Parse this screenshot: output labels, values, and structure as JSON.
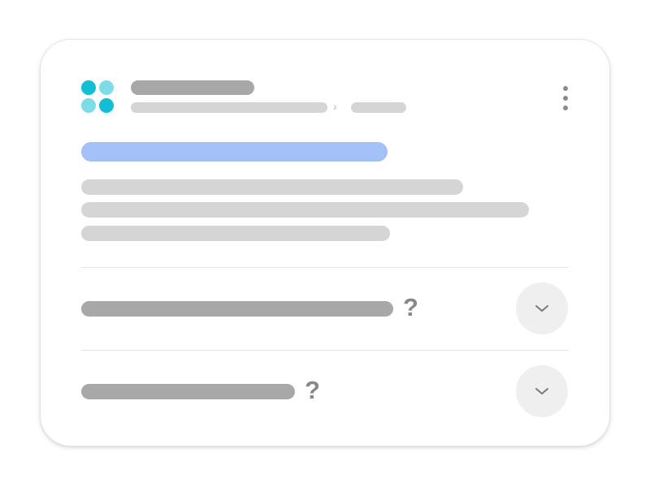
{
  "header": {
    "logo": "four-dot-logo-icon",
    "breadcrumb_separator": "›",
    "menu_icon": "more-vertical-icon"
  },
  "faq": {
    "items": [
      {
        "question_mark": "?",
        "toggle_icon": "chevron-down-icon"
      },
      {
        "question_mark": "?",
        "toggle_icon": "chevron-down-icon"
      }
    ]
  },
  "colors": {
    "title_placeholder": "#a3c1f7",
    "logo_dark": "#12bed4",
    "logo_light": "#7ddce8",
    "placeholder_dark": "#a8a8a8",
    "placeholder_light": "#d5d5d5",
    "button_bg": "#efefef"
  }
}
